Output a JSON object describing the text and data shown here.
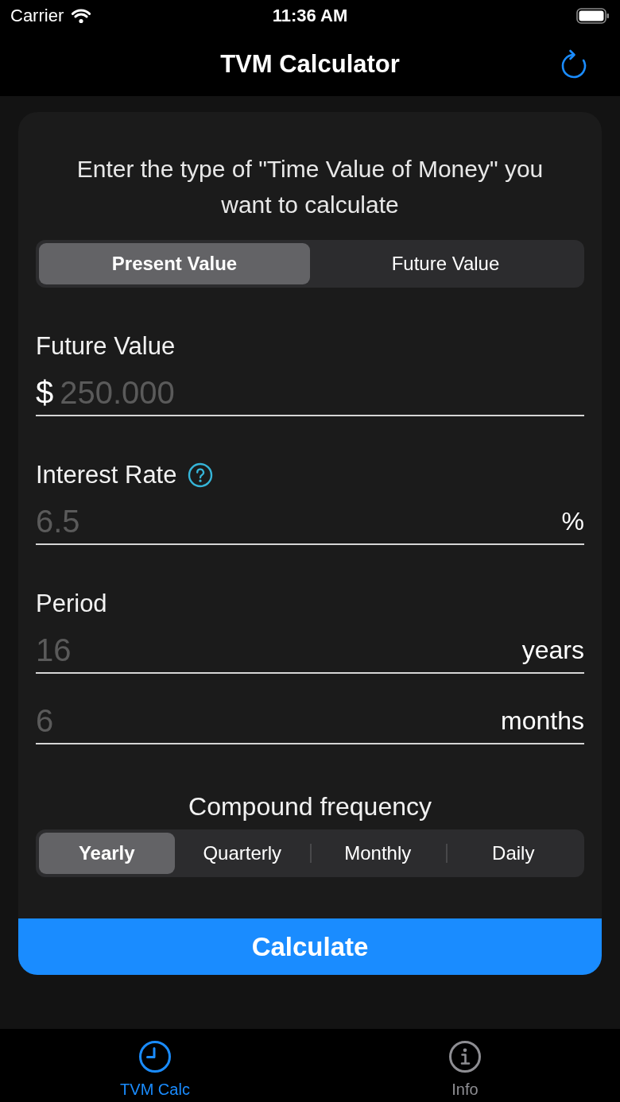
{
  "status_bar": {
    "carrier": "Carrier",
    "time": "11:36 AM"
  },
  "nav_bar": {
    "title": "TVM Calculator"
  },
  "form": {
    "prompt": "Enter the type of \"Time Value of Money\" you want to calculate",
    "value_type": [
      {
        "label": "Present Value",
        "selected": true
      },
      {
        "label": "Future Value",
        "selected": false
      }
    ],
    "sections": [
      {
        "label": "Future Value",
        "help": false,
        "inputs": [
          {
            "prefix": "$",
            "placeholder": "250.000"
          }
        ]
      },
      {
        "label": "Interest Rate",
        "help": true,
        "inputs": [
          {
            "placeholder": "6.5",
            "suffix": "%"
          }
        ]
      },
      {
        "label": "Period",
        "help": false,
        "inputs": [
          {
            "placeholder": "16",
            "suffix": "years"
          },
          {
            "placeholder": "6",
            "suffix": "months"
          }
        ]
      }
    ],
    "compound_frequency": {
      "title": "Compound frequency",
      "options": [
        {
          "label": "Yearly",
          "selected": true
        },
        {
          "label": "Quarterly",
          "selected": false
        },
        {
          "label": "Monthly",
          "selected": false
        },
        {
          "label": "Daily",
          "selected": false
        }
      ]
    },
    "calculate_button": {
      "label": "Calculate"
    }
  },
  "tab_bar": [
    {
      "label": "TVM Calc",
      "selected": true
    },
    {
      "label": "Info",
      "selected": false
    }
  ]
}
